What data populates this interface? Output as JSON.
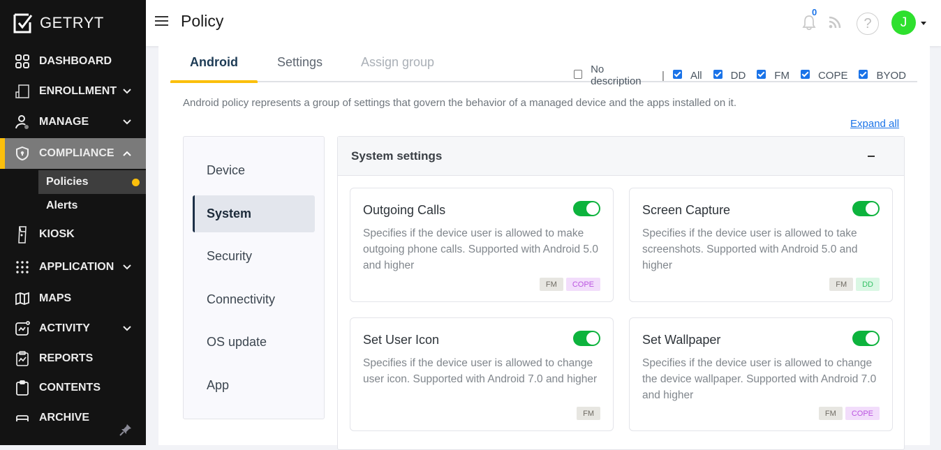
{
  "app": {
    "brand": "GETRYT",
    "accent_color": "#fbbf0c"
  },
  "sidebar": {
    "items": [
      {
        "label": "DASHBOARD",
        "icon": "dashboard-icon",
        "has_chevron": false
      },
      {
        "label": "ENROLLMENT",
        "icon": "enrollment-icon",
        "has_chevron": true
      },
      {
        "label": "MANAGE",
        "icon": "manage-user-icon",
        "has_chevron": true
      },
      {
        "label": "COMPLIANCE",
        "icon": "shield-icon",
        "has_chevron": true,
        "expanded": true,
        "active": true
      },
      {
        "label": "KIOSK",
        "icon": "kiosk-icon",
        "has_chevron": false
      },
      {
        "label": "APPLICATION",
        "icon": "apps-grid-icon",
        "has_chevron": true
      },
      {
        "label": "MAPS",
        "icon": "map-icon",
        "has_chevron": false
      },
      {
        "label": "ACTIVITY",
        "icon": "activity-icon",
        "has_chevron": true
      },
      {
        "label": "REPORTS",
        "icon": "reports-icon",
        "has_chevron": false
      },
      {
        "label": "CONTENTS",
        "icon": "clipboard-icon",
        "has_chevron": false
      },
      {
        "label": "ARCHIVE",
        "icon": "archive-icon",
        "has_chevron": false
      }
    ],
    "compliance_sub": [
      {
        "label": "Policies",
        "active": true
      },
      {
        "label": "Alerts",
        "active": false
      }
    ]
  },
  "topbar": {
    "title": "Policy",
    "notification_count": "0",
    "help_label": "?",
    "avatar_initial": "J",
    "avatar_color": "#2ee02e"
  },
  "tabs": [
    {
      "label": "Android",
      "active": true
    },
    {
      "label": "Settings",
      "active": false
    },
    {
      "label": "Assign group",
      "active": false,
      "disabled": true
    }
  ],
  "filters": {
    "no_description": {
      "label": "No description",
      "checked": false
    },
    "separator": "|",
    "options": [
      {
        "label": "All",
        "checked": true
      },
      {
        "label": "DD",
        "checked": true
      },
      {
        "label": "FM",
        "checked": true
      },
      {
        "label": "COPE",
        "checked": true
      },
      {
        "label": "BYOD",
        "checked": true
      }
    ]
  },
  "description": "Android policy represents a group of settings that govern the behavior of a managed device and the apps installed on it.",
  "expand_all": "Expand all",
  "policy_nav": [
    {
      "label": "Device",
      "active": false
    },
    {
      "label": "System",
      "active": true
    },
    {
      "label": "Security",
      "active": false
    },
    {
      "label": "Connectivity",
      "active": false
    },
    {
      "label": "OS update",
      "active": false
    },
    {
      "label": "App",
      "active": false
    }
  ],
  "section": {
    "title": "System settings",
    "collapse_symbol": "–",
    "cards": [
      {
        "title": "Outgoing Calls",
        "enabled": true,
        "description": "Specifies if the device user is allowed to make outgoing phone calls. Supported with Android 5.0 and higher",
        "badges": [
          "FM",
          "COPE"
        ]
      },
      {
        "title": "Screen Capture",
        "enabled": true,
        "description": "Specifies if the device user is allowed to take screenshots. Supported with Android 5.0 and higher",
        "badges": [
          "FM",
          "DD"
        ]
      },
      {
        "title": "Set User Icon",
        "enabled": true,
        "description": "Specifies if the device user is allowed to change user icon. Supported with Android 7.0 and higher",
        "badges": [
          "FM"
        ]
      },
      {
        "title": "Set Wallpaper",
        "enabled": true,
        "description": "Specifies if the device user is allowed to change the device wallpaper. Supported with Android 7.0 and higher",
        "badges": [
          "FM",
          "COPE"
        ]
      }
    ]
  }
}
